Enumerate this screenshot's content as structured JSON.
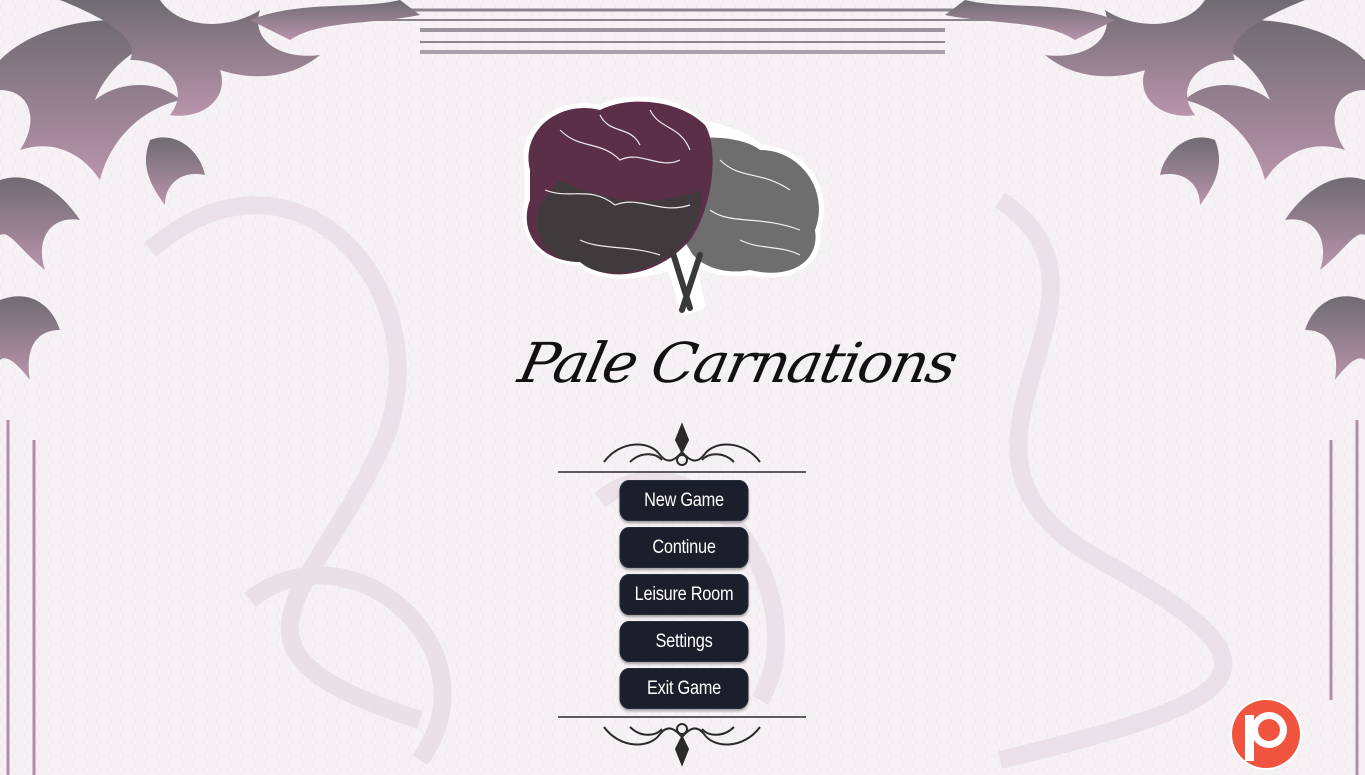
{
  "game": {
    "title": "Pale Carnations"
  },
  "menu": {
    "items": [
      {
        "label": "New Game"
      },
      {
        "label": "Continue"
      },
      {
        "label": "Leisure Room"
      },
      {
        "label": "Settings"
      },
      {
        "label": "Exit Game"
      }
    ]
  },
  "icons": {
    "logo": "carnation-flowers-icon",
    "patreon": "patreon-icon"
  },
  "colors": {
    "button_bg": "#1b1f2b",
    "button_text": "#ffffff",
    "frame": "#6e6a70",
    "frame_pink": "#a07890",
    "flower_dark": "#5a2a45",
    "flower_grey": "#6d6d6d",
    "patreon": "#f0543e"
  }
}
